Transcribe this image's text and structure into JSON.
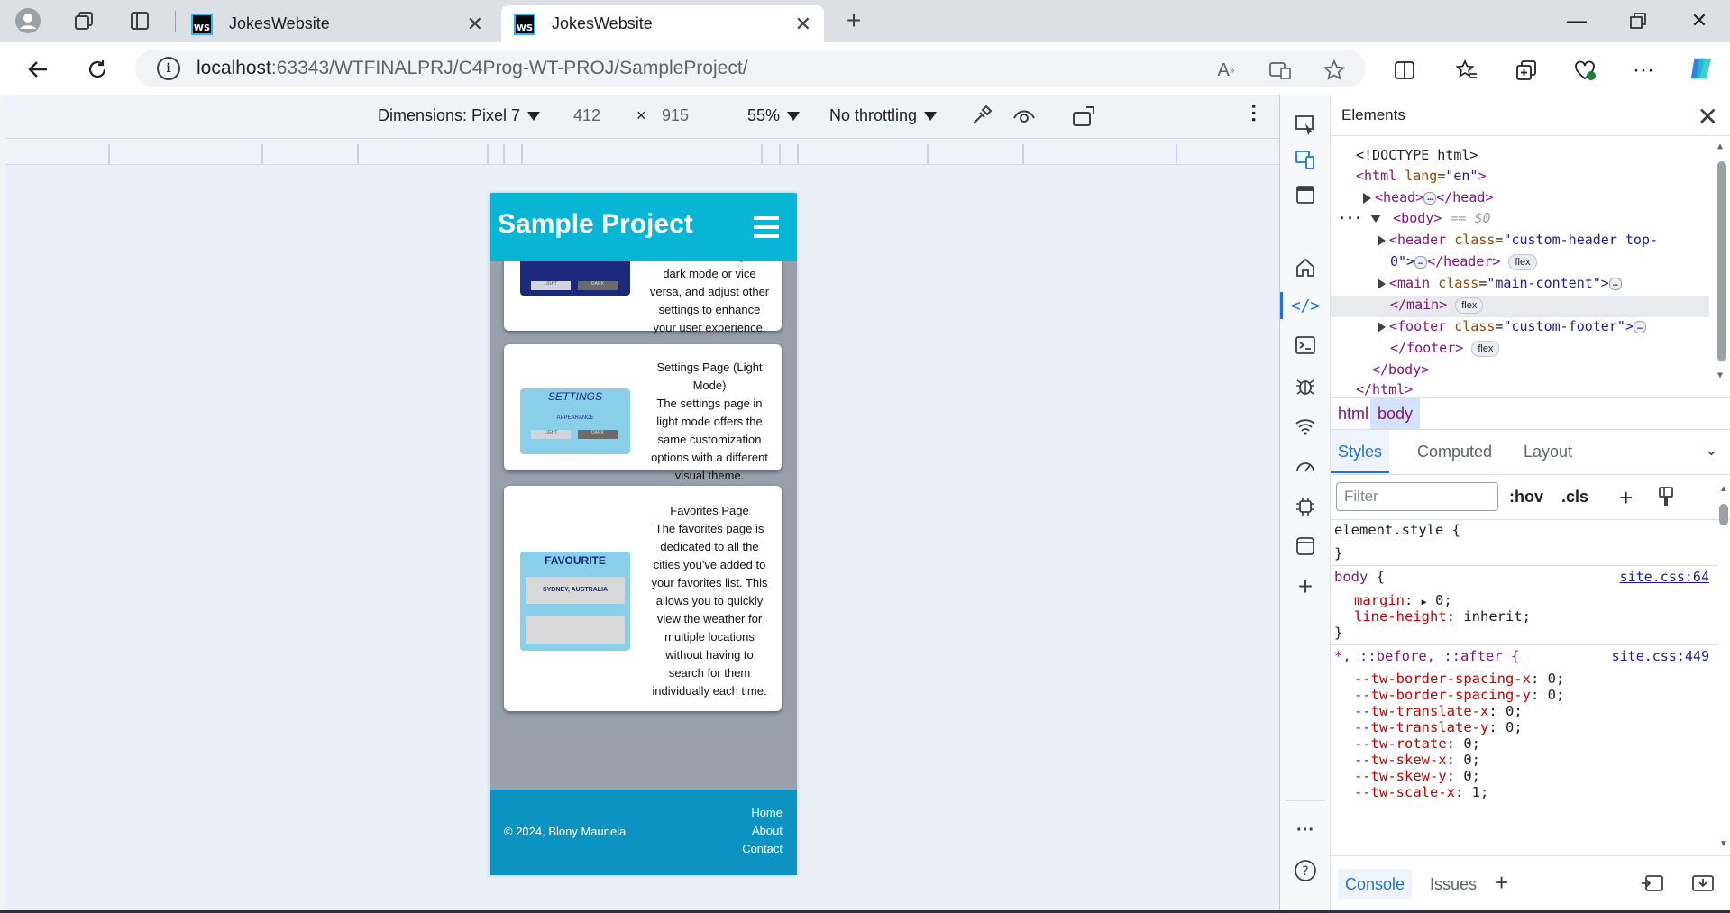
{
  "browser": {
    "tabs": [
      {
        "title": "JokesWebsite",
        "favicon": "WS"
      },
      {
        "title": "JokesWebsite",
        "favicon": "WS"
      }
    ],
    "url_host": "localhost",
    "url_path": ":63343/WTFINALPRJ/C4Prog-WT-PROJ/SampleProject/"
  },
  "device_toolbar": {
    "dimensions": "Dimensions: Pixel 7",
    "width": "412",
    "times": "×",
    "height": "915",
    "zoom": "55%",
    "throttling": "No throttling"
  },
  "site": {
    "title": "Sample Project",
    "cards": [
      {
        "text": "the theme from light to dark mode or vice versa, and adjust other settings to enhance your user experience.",
        "thumb_labels": [
          "LIGHT",
          "DARK"
        ]
      },
      {
        "heading": "Settings Page (Light Mode)",
        "text": "The settings page in light mode offers the same customization options with a different visual theme.",
        "thumb_title": "SETTINGS",
        "thumb_sub": "APPEARANCE",
        "thumb_labels": [
          "LIGHT",
          "DARK"
        ]
      },
      {
        "heading": "Favorites Page",
        "text": "The favorites page is dedicated to all the cities you've added to your favorites list. This allows you to quickly view the weather for multiple locations without having to search for them individually each time.",
        "thumb_title": "FAVOURITE",
        "thumb_item": "SYDNEY, AUSTRALIA"
      }
    ],
    "footer": {
      "copyright": "© 2024, Blony Maunela",
      "links": [
        "Home",
        "About",
        "Contact"
      ]
    }
  },
  "devtools": {
    "panel_title": "Elements",
    "dom": {
      "doctype": "<!DOCTYPE html>",
      "html_open": "<html",
      "lang_attr": "lang",
      "lang_val": "\"en\"",
      "head": "<head>",
      "head_close": "</head>",
      "body": "<body>",
      "body_marker": "== $0",
      "header": "<header",
      "header_class_val_1": "\"custom-header top-",
      "header_class_val_2": "0\">",
      "header_close": "</header>",
      "main": "<main",
      "main_class_val": "\"main-content\">",
      "main_close": "</main>",
      "footer": "<footer",
      "footer_class_val": "\"custom-footer\">",
      "footer_close": "</footer>",
      "body_close": "</body>",
      "html_close": "</html>",
      "class_attr": "class=",
      "flex_badge": "flex",
      "ellipsis": "…"
    },
    "breadcrumbs": [
      "html",
      "body"
    ],
    "style_tabs": [
      "Styles",
      "Computed",
      "Layout"
    ],
    "filter_placeholder": "Filter",
    "hov": ":hov",
    "cls": ".cls",
    "rules": {
      "element_style": "element.style {",
      "close_brace": "}",
      "body_selector": "body",
      "body_source": "site.css:64",
      "body_props": [
        {
          "name": "margin",
          "value": "0;"
        },
        {
          "name": "line-height",
          "value": "inherit;"
        }
      ],
      "universal_selector": "*, ::before, ::after {",
      "universal_source": "site.css:449",
      "universal_props": [
        {
          "name": "--tw-border-spacing-x",
          "value": "0;"
        },
        {
          "name": "--tw-border-spacing-y",
          "value": "0;"
        },
        {
          "name": "--tw-translate-x",
          "value": "0;"
        },
        {
          "name": "--tw-translate-y",
          "value": "0;"
        },
        {
          "name": "--tw-rotate",
          "value": "0;"
        },
        {
          "name": "--tw-skew-x",
          "value": "0;"
        },
        {
          "name": "--tw-skew-y",
          "value": "0;"
        },
        {
          "name": "--tw-scale-x",
          "value": "1;"
        }
      ]
    },
    "bottom_tabs": [
      "Console",
      "Issues"
    ]
  },
  "colors": {
    "site_header": "#08b5d5",
    "site_footer": "#0d93c2",
    "devtools_accent": "#1a73e8"
  }
}
